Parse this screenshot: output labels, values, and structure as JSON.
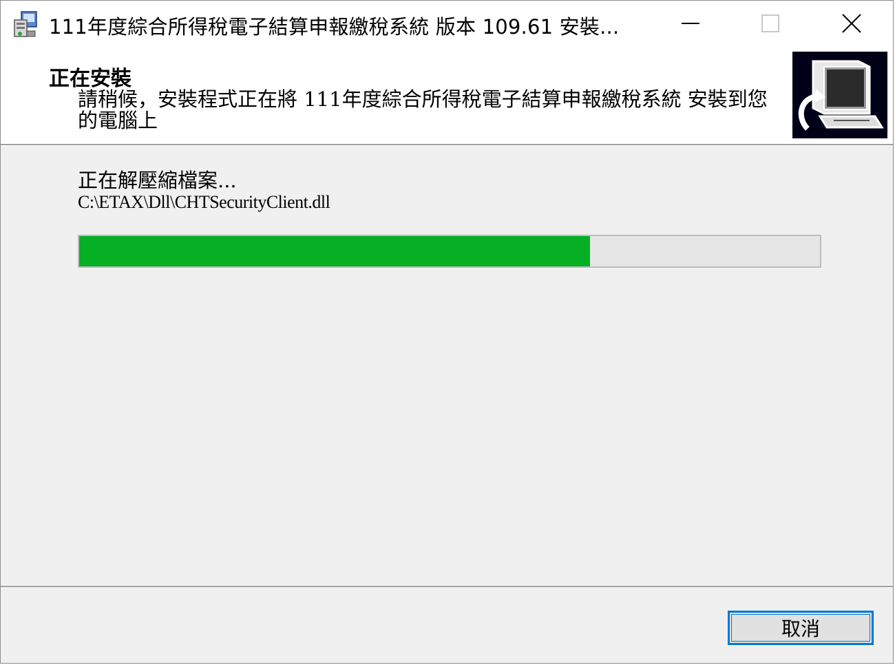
{
  "window": {
    "title": "111年度綜合所得稅電子結算申報繳稅系統 版本 109.61 安裝..."
  },
  "titlebar": {
    "minimize_icon": "minimize-icon",
    "maximize_icon": "maximize-icon",
    "close_icon": "close-icon"
  },
  "header": {
    "title": "正在安裝",
    "description": "請稍候，安裝程式正在將 111年度綜合所得稅電子結算申報繳稅系統 安裝到您的電腦上"
  },
  "main": {
    "status": "正在解壓縮檔案...",
    "file_path": "C:\\ETAX\\Dll\\CHTSecurityClient.dll",
    "progress_percent": 69
  },
  "footer": {
    "cancel_label": "取消"
  },
  "colors": {
    "progress_fill": "#06b025",
    "focus_border": "#0078d7"
  }
}
